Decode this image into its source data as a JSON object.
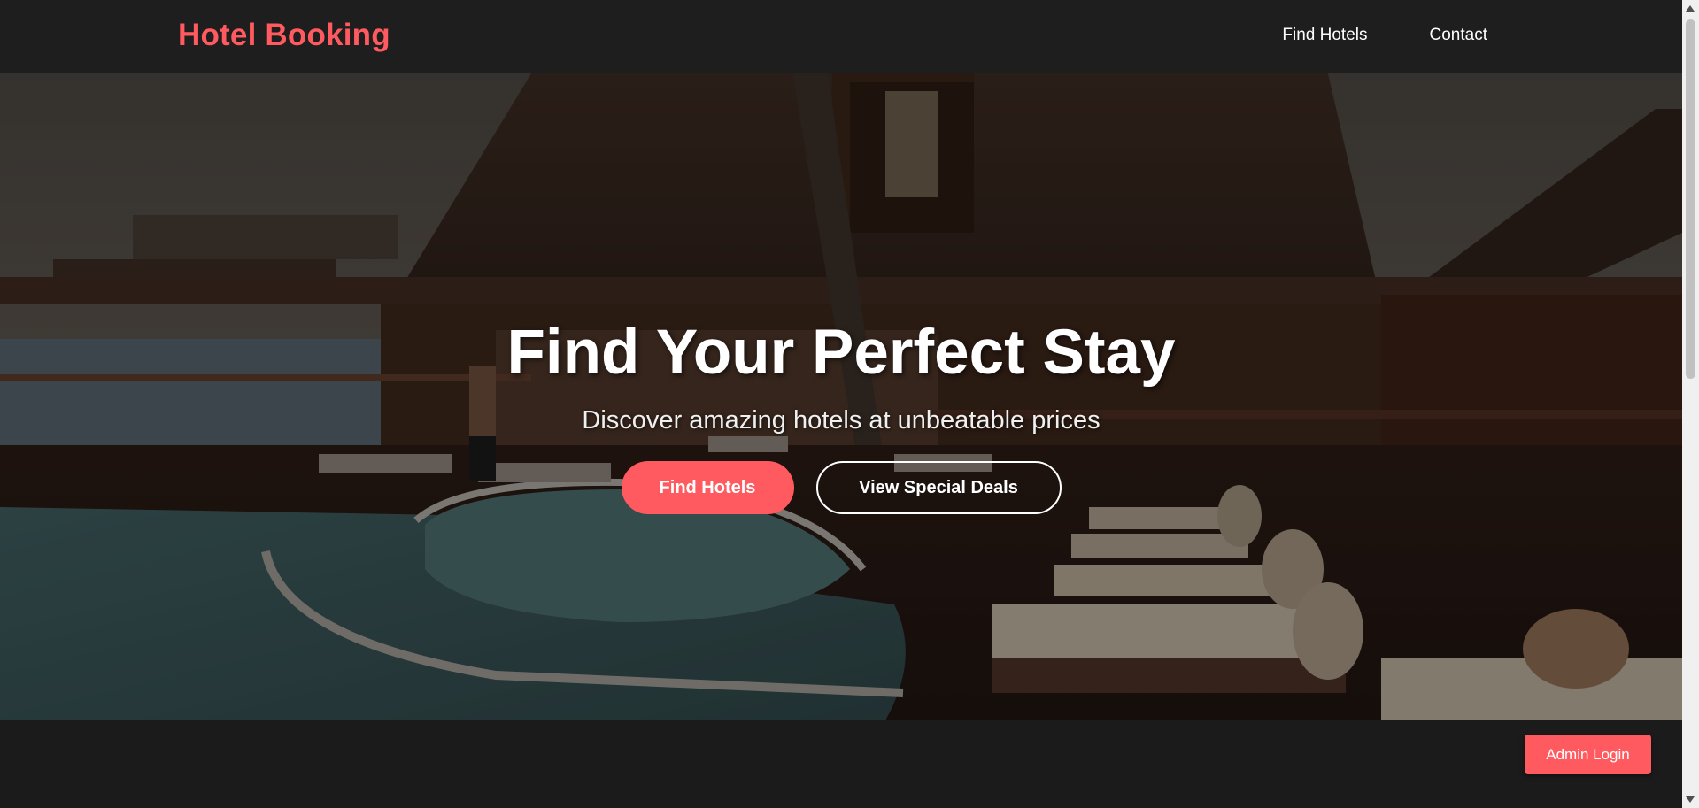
{
  "header": {
    "brand": "Hotel Booking",
    "nav": [
      {
        "label": "Find Hotels"
      },
      {
        "label": "Contact"
      }
    ]
  },
  "hero": {
    "title": "Find Your Perfect Stay",
    "subtitle": "Discover amazing hotels at unbeatable prices",
    "primary_button": "Find Hotels",
    "secondary_button": "View Special Deals",
    "background_image": "resort-pool-lodge-photo"
  },
  "footer": {
    "admin_button": "Admin Login"
  },
  "colors": {
    "accent": "#ff5a5f",
    "nav_background": "#1e1e1e",
    "page_background": "#1b1b1b"
  }
}
